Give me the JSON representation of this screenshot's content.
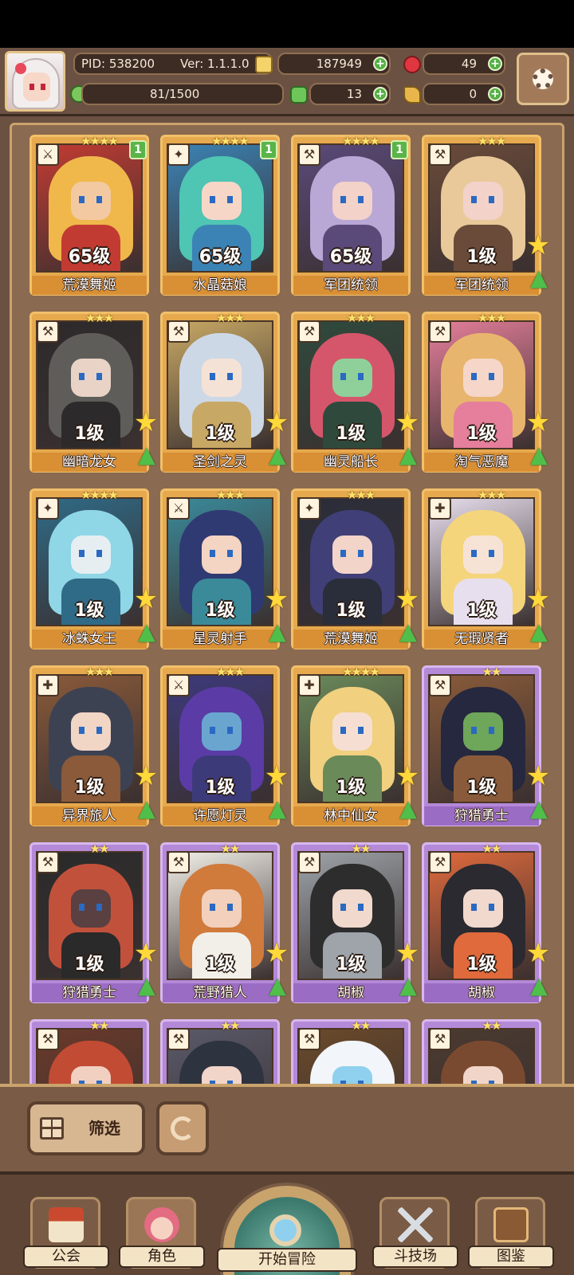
{
  "header": {
    "pid": "PID: 538200",
    "version": "Ver: 1.1.1.0",
    "gold": "187949",
    "gems": "49",
    "stamina": "81/1500",
    "clover": "13",
    "keys": "0"
  },
  "cards": [
    {
      "level": "65级",
      "name": "荒漠舞姬",
      "stars": "★★★★",
      "badge": "1",
      "rarity": "gold",
      "icon": "⚔",
      "palette": [
        "#f0b84b",
        "#f3c9a2",
        "#c23b32"
      ],
      "show_actions": false
    },
    {
      "level": "65级",
      "name": "水晶菇娘",
      "stars": "★★★★",
      "badge": "1",
      "rarity": "gold",
      "icon": "✦",
      "palette": [
        "#4fc5b3",
        "#f6d6c7",
        "#3b83b5"
      ],
      "show_actions": false
    },
    {
      "level": "65级",
      "name": "军团统领",
      "stars": "★★★★",
      "badge": "1",
      "rarity": "gold",
      "icon": "⚒",
      "palette": [
        "#b9a7d6",
        "#f2d2c9",
        "#5a4a7a"
      ],
      "show_actions": false
    },
    {
      "level": "1级",
      "name": "军团统领",
      "stars": "★★★",
      "badge": "",
      "rarity": "gold",
      "icon": "⚒",
      "palette": [
        "#e9c99a",
        "#f2d2c9",
        "#6a4b3a"
      ],
      "show_actions": true
    },
    {
      "level": "1级",
      "name": "幽暗龙女",
      "stars": "★★★",
      "badge": "",
      "rarity": "gold",
      "icon": "⚒",
      "palette": [
        "#5e5d5a",
        "#e9d3c6",
        "#2d2a2b"
      ],
      "show_actions": true
    },
    {
      "level": "1级",
      "name": "圣剑之灵",
      "stars": "★★★",
      "badge": "",
      "rarity": "gold",
      "icon": "⚒",
      "palette": [
        "#cdd8e6",
        "#f5e2d6",
        "#c8a865"
      ],
      "show_actions": true
    },
    {
      "level": "1级",
      "name": "幽灵船长",
      "stars": "★★★",
      "badge": "",
      "rarity": "gold",
      "icon": "⚒",
      "palette": [
        "#d5566b",
        "#8fd09a",
        "#2f4a3d"
      ],
      "show_actions": true
    },
    {
      "level": "1级",
      "name": "淘气恶魔",
      "stars": "★★★",
      "badge": "",
      "rarity": "gold",
      "icon": "⚒",
      "palette": [
        "#e8b56e",
        "#f5d6c8",
        "#e57f9b"
      ],
      "show_actions": true
    },
    {
      "level": "1级",
      "name": "冰蛛女王",
      "stars": "★★★★",
      "badge": "",
      "rarity": "gold",
      "icon": "✦",
      "palette": [
        "#8fd6e6",
        "#e6eef2",
        "#2f6a86"
      ],
      "show_actions": true
    },
    {
      "level": "1级",
      "name": "星灵射手",
      "stars": "★★★",
      "badge": "",
      "rarity": "gold",
      "icon": "⚔",
      "palette": [
        "#2f3a72",
        "#f4d4c2",
        "#3a8a9a"
      ],
      "show_actions": true
    },
    {
      "level": "1级",
      "name": "荒漠舞姬",
      "stars": "★★★",
      "badge": "",
      "rarity": "gold",
      "icon": "✦",
      "palette": [
        "#403f78",
        "#f2d4c8",
        "#2a2d3a"
      ],
      "show_actions": true
    },
    {
      "level": "1级",
      "name": "无瑕贤者",
      "stars": "★★★",
      "badge": "",
      "rarity": "gold",
      "icon": "✚",
      "palette": [
        "#f4d57c",
        "#f7e2d6",
        "#e8dfee"
      ],
      "show_actions": true
    },
    {
      "level": "1级",
      "name": "异界旅人",
      "stars": "★★★",
      "badge": "",
      "rarity": "gold",
      "icon": "✚",
      "palette": [
        "#3d4252",
        "#f1d5c5",
        "#8a5a3a"
      ],
      "show_actions": true
    },
    {
      "level": "1级",
      "name": "许愿灯灵",
      "stars": "★★★",
      "badge": "",
      "rarity": "gold",
      "icon": "⚔",
      "palette": [
        "#5b3ca6",
        "#6aa5cf",
        "#3d3a7a"
      ],
      "show_actions": true
    },
    {
      "level": "1级",
      "name": "林中仙女",
      "stars": "★★★★",
      "badge": "",
      "rarity": "gold",
      "icon": "✚",
      "palette": [
        "#f1d07f",
        "#f6dfd2",
        "#6a8a5a"
      ],
      "show_actions": true
    },
    {
      "level": "1级",
      "name": "狩猎勇士",
      "stars": "★★",
      "badge": "",
      "rarity": "purple",
      "icon": "⚒",
      "palette": [
        "#25283e",
        "#6ea65a",
        "#8a5b3a"
      ],
      "show_actions": true
    },
    {
      "level": "1级",
      "name": "狩猎勇士",
      "stars": "★★",
      "badge": "",
      "rarity": "purple",
      "icon": "⚒",
      "palette": [
        "#c2513c",
        "#5a4040",
        "#2a2a2a"
      ],
      "show_actions": true
    },
    {
      "level": "1级",
      "name": "荒野猎人",
      "stars": "★★",
      "badge": "",
      "rarity": "purple",
      "icon": "⚒",
      "palette": [
        "#d07a3c",
        "#f2d0bc",
        "#f2efe8"
      ],
      "show_actions": true
    },
    {
      "level": "1级",
      "name": "胡椒",
      "stars": "★★",
      "badge": "",
      "rarity": "purple",
      "icon": "⚒",
      "palette": [
        "#2d2d2d",
        "#f1d9cd",
        "#9ea4aa"
      ],
      "show_actions": true
    },
    {
      "level": "1级",
      "name": "胡椒",
      "stars": "★★",
      "badge": "",
      "rarity": "purple",
      "icon": "⚒",
      "palette": [
        "#2a2a30",
        "#f1d9cd",
        "#e06a3c"
      ],
      "show_actions": true
    },
    {
      "level": "",
      "name": "",
      "stars": "★★",
      "badge": "",
      "rarity": "purple",
      "icon": "⚒",
      "palette": [
        "#c24b34",
        "#f1d0c2",
        "#6a3a2a"
      ],
      "show_actions": false
    },
    {
      "level": "",
      "name": "",
      "stars": "★★",
      "badge": "",
      "rarity": "purple",
      "icon": "⚒",
      "palette": [
        "#2e3340",
        "#f1d5c8",
        "#5a5a6a"
      ],
      "show_actions": false
    },
    {
      "level": "",
      "name": "",
      "stars": "★★",
      "badge": "",
      "rarity": "purple",
      "icon": "⚒",
      "palette": [
        "#f2f5fa",
        "#8fd0ee",
        "#6a4a2a"
      ],
      "show_actions": false
    },
    {
      "level": "",
      "name": "",
      "stars": "★★",
      "badge": "",
      "rarity": "purple",
      "icon": "⚒",
      "palette": [
        "#7a4a30",
        "#f1d5c8",
        "#4a3a30"
      ],
      "show_actions": false
    }
  ],
  "panel": {
    "filter_label": "筛选"
  },
  "nav": {
    "guild": "公会",
    "character": "角色",
    "adventure": "开始冒险",
    "arena": "斗技场",
    "codex": "图鉴"
  },
  "colors": {
    "frame": "#6b5142",
    "gold_card": "#e6a94e",
    "purple_card": "#b489d8",
    "accent_green": "#53b043"
  }
}
